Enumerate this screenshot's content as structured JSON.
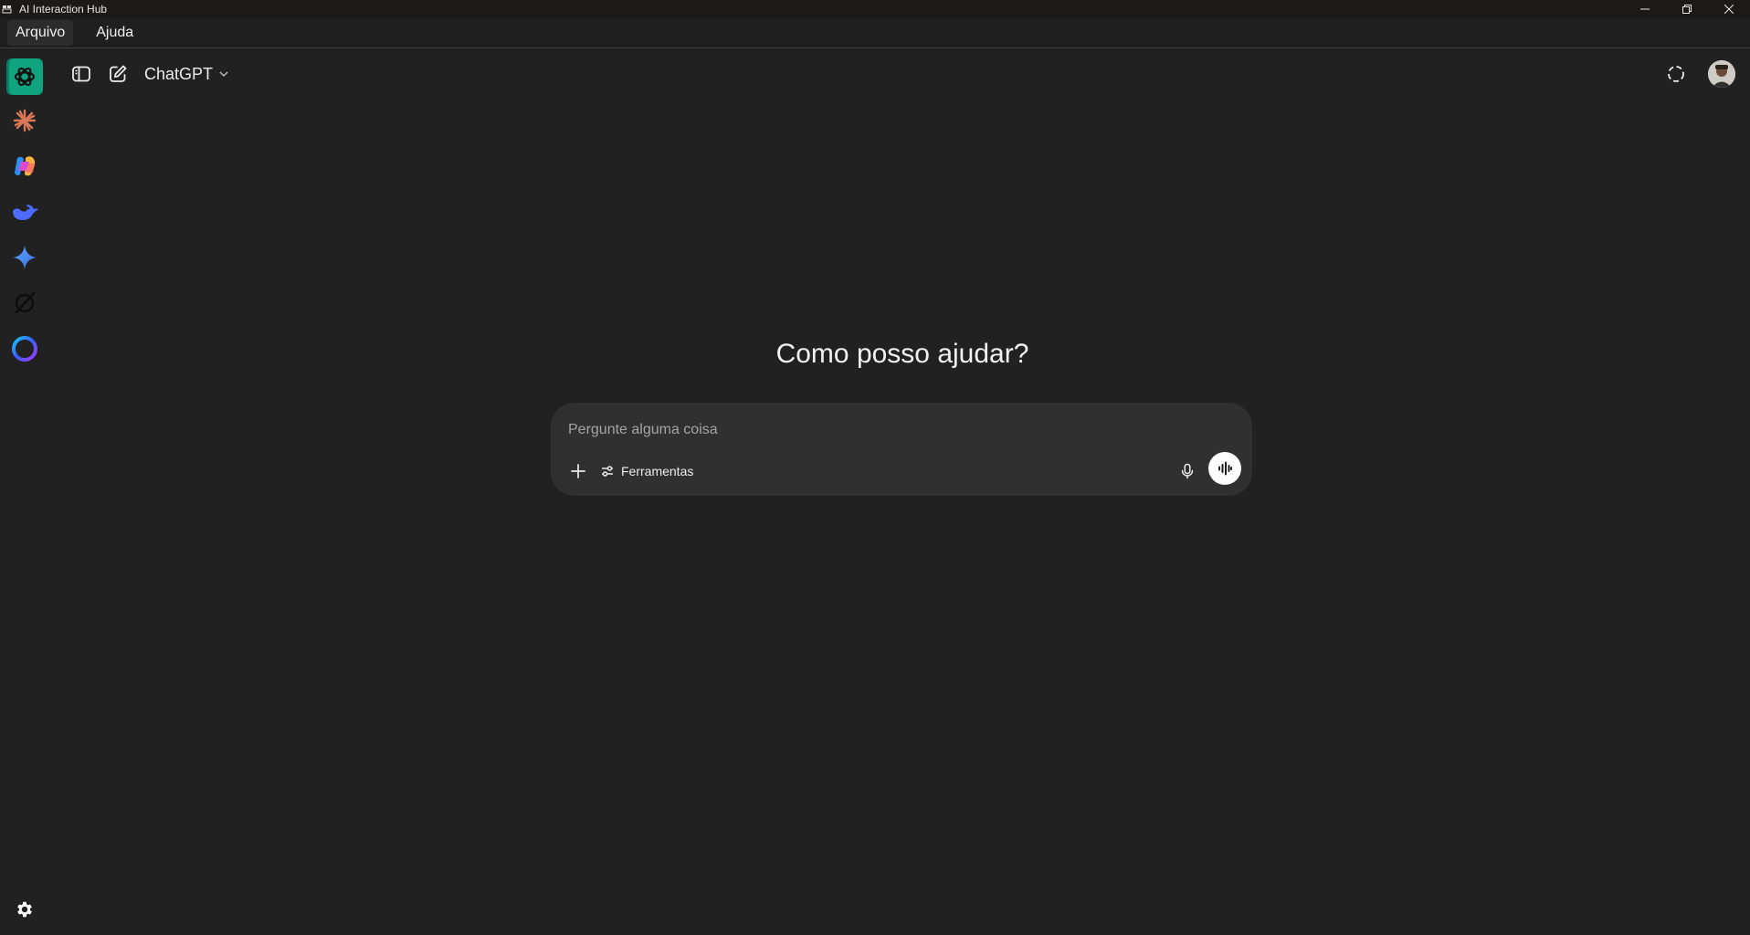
{
  "window": {
    "title": "AI Interaction Hub",
    "controls": [
      "minimize-icon",
      "restore-icon",
      "close-icon"
    ]
  },
  "menubar": {
    "items": [
      {
        "label": "Arquivo",
        "active": true
      },
      {
        "label": "Ajuda",
        "active": false
      }
    ]
  },
  "rail": {
    "items": [
      {
        "icon": "chatgpt-logo-icon",
        "active": true,
        "color": "#10a37f"
      },
      {
        "icon": "claude-logo-icon",
        "active": false,
        "color": "#d97757"
      },
      {
        "icon": "copilot-logo-icon",
        "active": false,
        "color": "#4ba0ff"
      },
      {
        "icon": "deepseek-logo-icon",
        "active": false,
        "color": "#4d6bfe"
      },
      {
        "icon": "gemini-logo-icon",
        "active": false,
        "color": "#4f8df5"
      },
      {
        "icon": "grok-logo-icon",
        "active": false,
        "color": "#111111"
      },
      {
        "icon": "meta-ai-logo-icon",
        "active": false,
        "color": "#5b5bff"
      }
    ],
    "settings_icon": "gear-icon"
  },
  "header": {
    "model_label": "ChatGPT",
    "icons": [
      "sidebar-toggle-icon",
      "new-chat-icon",
      "chevron-down-icon",
      "temporary-chat-icon",
      "avatar"
    ]
  },
  "main": {
    "headline": "Como posso ajudar?",
    "composer": {
      "placeholder": "Pergunte alguma coisa",
      "value": "",
      "tools_label": "Ferramentas"
    }
  },
  "colors": {
    "background": "#212121",
    "composer": "#303030",
    "accent": "#10a37f"
  }
}
